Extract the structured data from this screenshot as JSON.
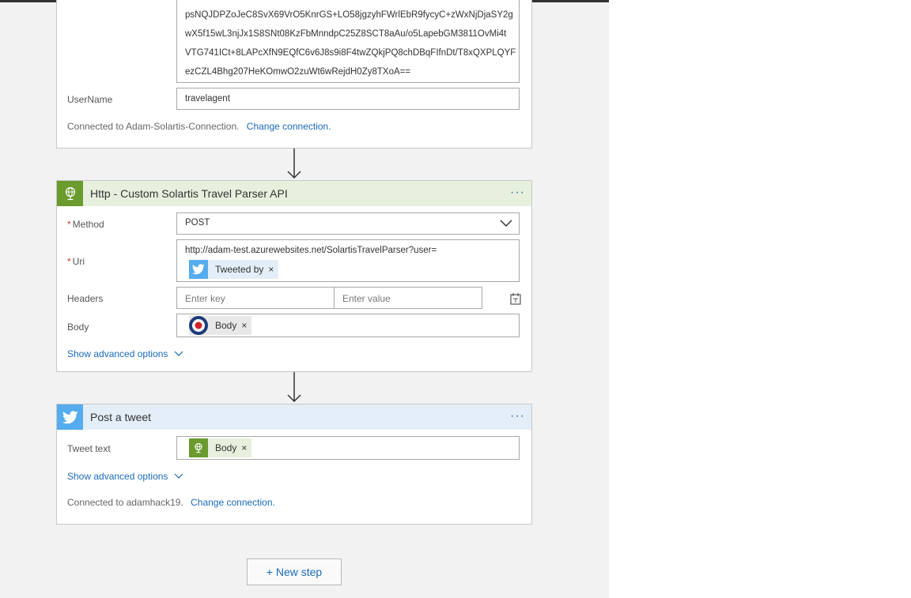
{
  "colors": {
    "canvas_bg": "#f2f2f2",
    "http_header_bg": "#e6f0dd",
    "http_icon_bg": "#6b9a2f",
    "twitter_header_bg": "#e4eef8",
    "twitter_icon_bg": "#55acee",
    "link": "#1a6bb8",
    "required": "#c43c2e"
  },
  "connection_card": {
    "credential_lines": [
      "psNQJDPZoJeC8SvX69VrO5KnrGS+LO58jgzyhFWrlEbR9fycyC+zWxNjDjaSY2g",
      "wX5f15wL3njJx1S8SNt08KzFbMnndpC25Z8SCT8aAu/o5LapebGM3811OvMi4t",
      "VTG741ICt+8LAPcXfN9EQfC6v6J8s9i8F4twZQkjPQ8chDBqFIfnDt/T8xQXPLQYF",
      "ezCZL4Bhg207HeKOmwO2zuWt6wRejdH0Zy8TXoA=="
    ],
    "username_label": "UserName",
    "username_value": "travelagent",
    "connected_text": "Connected to Adam-Solartis-Connection.",
    "change_connection": "Change connection."
  },
  "http_card": {
    "icon": "globe-icon",
    "title": "Http - Custom Solartis Travel Parser API",
    "menu": "···",
    "method_required": "*",
    "method_label": "Method",
    "method_value": "POST",
    "uri_required": "*",
    "uri_label": "Uri",
    "uri_value": "http://adam-test.azurewebsites.net/SolartisTravelParser?user=",
    "uri_token": "Tweeted by",
    "headers_label": "Headers",
    "headers_key_placeholder": "Enter key",
    "headers_value_placeholder": "Enter value",
    "body_label": "Body",
    "body_token": "Body",
    "advanced": "Show advanced options"
  },
  "tweet_card": {
    "icon": "twitter-icon",
    "title": "Post a tweet",
    "menu": "···",
    "tweet_label": "Tweet text",
    "tweet_token": "Body",
    "advanced": "Show advanced options",
    "connected_text": "Connected to adamhack19.",
    "change_connection": "Change connection."
  },
  "new_step": "+ New step",
  "token_close": "×"
}
